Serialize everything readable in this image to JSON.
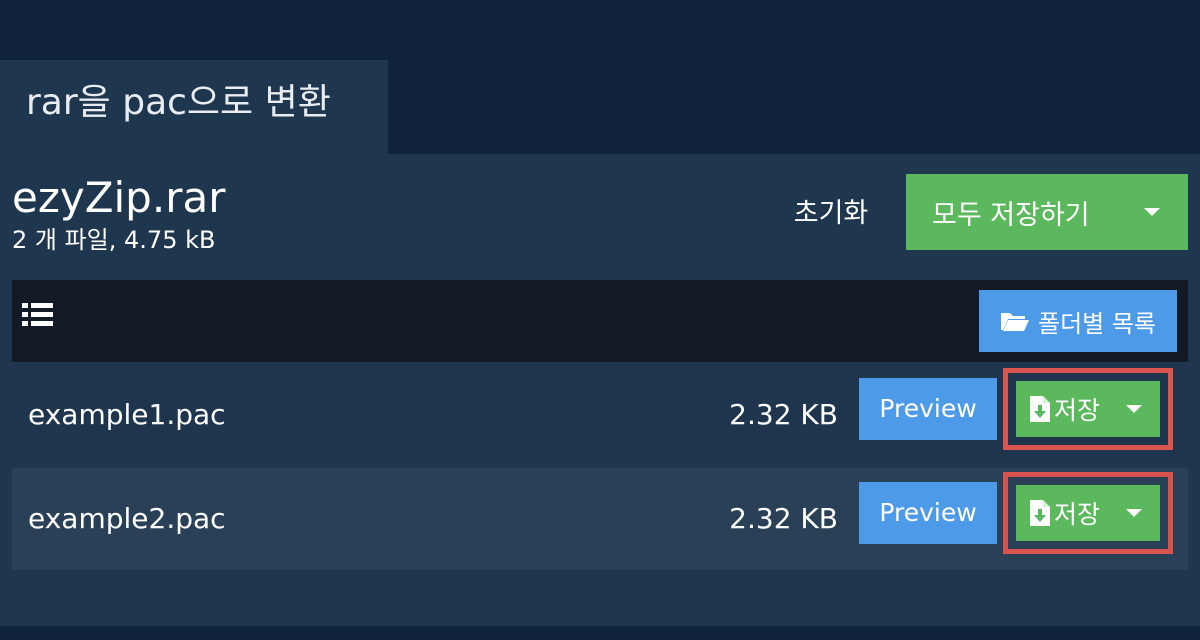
{
  "tab": {
    "title": "rar을 pac으로 변환"
  },
  "archive": {
    "name": "ezyZip.rar",
    "meta": "2 개 파일, 4.75 kB"
  },
  "actions": {
    "reset_label": "초기화",
    "save_all_label": "모두 저장하기"
  },
  "toolbar": {
    "list_icon": "list-icon",
    "folder_view_label": "폴더별 목록"
  },
  "files": [
    {
      "name": "example1.pac",
      "size": "2.32 KB",
      "preview_label": "Preview",
      "save_label": "저장"
    },
    {
      "name": "example2.pac",
      "size": "2.32 KB",
      "preview_label": "Preview",
      "save_label": "저장"
    }
  ],
  "colors": {
    "background": "#10253c",
    "panel": "#1f364f",
    "toolbar": "#111a25",
    "accent_green": "#5cb85c",
    "accent_blue": "#4d9ae8",
    "highlight_red": "#d9534f"
  }
}
